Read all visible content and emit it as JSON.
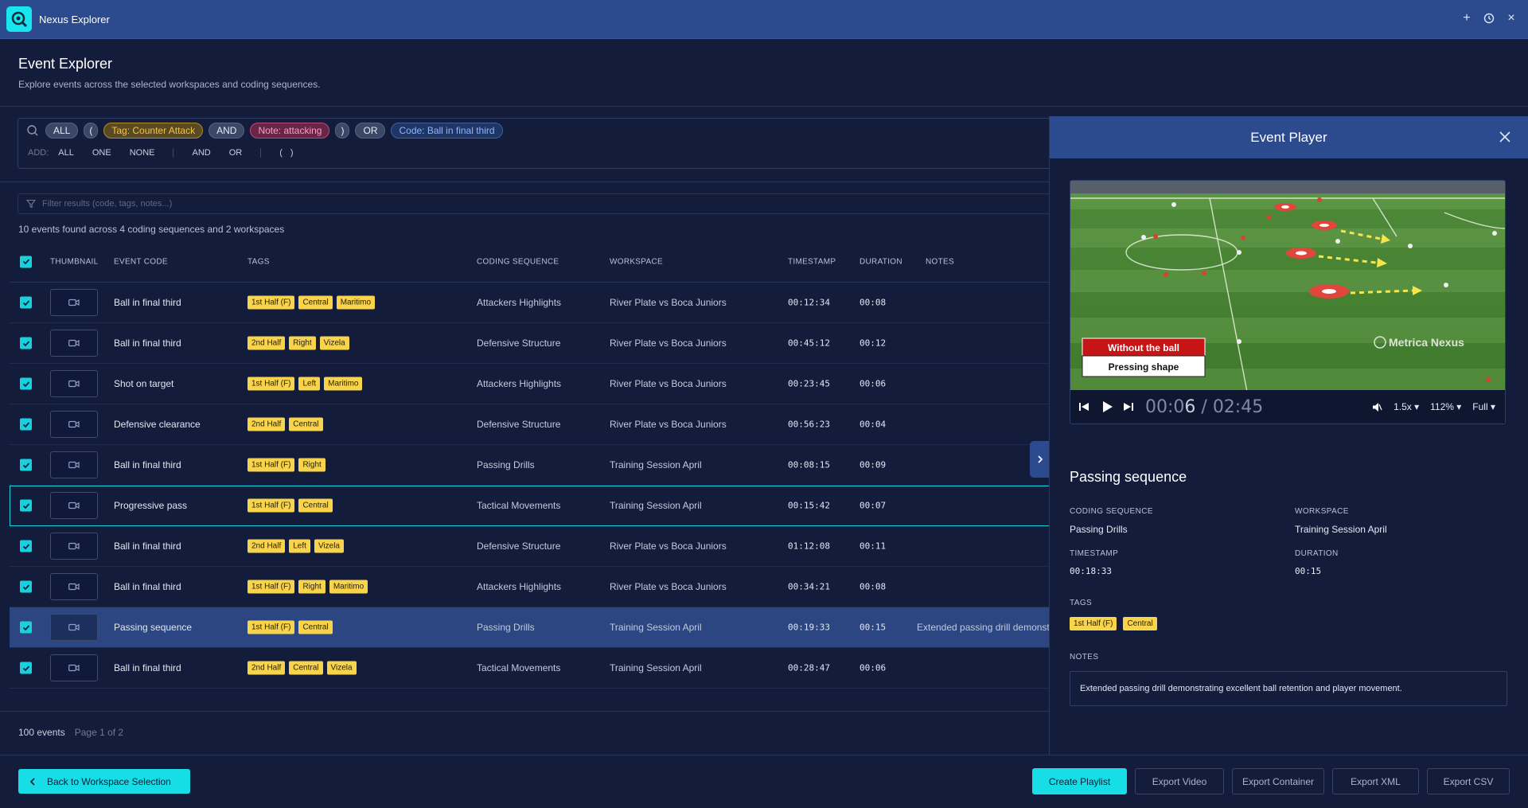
{
  "app": {
    "title": "Nexus Explorer"
  },
  "header": {
    "title": "Event Explorer",
    "subtitle": "Explore events across the selected workspaces and coding sequences."
  },
  "query": {
    "chips": [
      {
        "label": "ALL",
        "kind": "op"
      },
      {
        "label": "(",
        "kind": "op"
      },
      {
        "label": "Tag: Counter Attack",
        "kind": "tag"
      },
      {
        "label": "AND",
        "kind": "op"
      },
      {
        "label": "Note: attacking",
        "kind": "note"
      },
      {
        "label": ")",
        "kind": "op"
      },
      {
        "label": "OR",
        "kind": "op"
      },
      {
        "label": "Code: Ball in final third",
        "kind": "code"
      }
    ],
    "add_label": "ADD:",
    "add_buttons": [
      "ALL",
      "ONE",
      "NONE",
      "AND",
      "OR",
      "(",
      ")"
    ]
  },
  "filter": {
    "placeholder": "Filter results (code, tags, notes...)"
  },
  "results_text": "10 events found across 4 coding sequences and 2 workspaces",
  "table": {
    "headers": {
      "thumbnail": "THUMBNAIL",
      "event_code": "EVENT CODE",
      "tags": "TAGS",
      "coding_sequence": "CODING SEQUENCE",
      "workspace": "WORKSPACE",
      "timestamp": "TIMESTAMP",
      "duration": "DURATION",
      "notes": "NOTES"
    },
    "rows": [
      {
        "code": "Ball in final third",
        "tags": [
          "1st Half (F)",
          "Central",
          "Maritimo"
        ],
        "seq": "Attackers Highlights",
        "ws": "River Plate vs Boca Juniors",
        "ts": "00:12:34",
        "dur": "00:08",
        "notes": ""
      },
      {
        "code": "Ball in final third",
        "tags": [
          "2nd Half",
          "Right",
          "Vizela"
        ],
        "seq": "Defensive Structure",
        "ws": "River Plate vs Boca Juniors",
        "ts": "00:45:12",
        "dur": "00:12",
        "notes": ""
      },
      {
        "code": "Shot on target",
        "tags": [
          "1st Half (F)",
          "Left",
          "Maritimo"
        ],
        "seq": "Attackers Highlights",
        "ws": "River Plate vs Boca Juniors",
        "ts": "00:23:45",
        "dur": "00:06",
        "notes": ""
      },
      {
        "code": "Defensive clearance",
        "tags": [
          "2nd Half",
          "Central"
        ],
        "seq": "Defensive Structure",
        "ws": "River Plate vs Boca Juniors",
        "ts": "00:56:23",
        "dur": "00:04",
        "notes": ""
      },
      {
        "code": "Ball in final third",
        "tags": [
          "1st Half (F)",
          "Right"
        ],
        "seq": "Passing Drills",
        "ws": "Training Session April",
        "ts": "00:08:15",
        "dur": "00:09",
        "notes": ""
      },
      {
        "code": "Progressive pass",
        "tags": [
          "1st Half (F)",
          "Central"
        ],
        "seq": "Tactical Movements",
        "ws": "Training Session April",
        "ts": "00:15:42",
        "dur": "00:07",
        "notes": ""
      },
      {
        "code": "Ball in final third",
        "tags": [
          "2nd Half",
          "Left",
          "Vizela"
        ],
        "seq": "Defensive Structure",
        "ws": "River Plate vs Boca Juniors",
        "ts": "01:12:08",
        "dur": "00:11",
        "notes": ""
      },
      {
        "code": "Ball in final third",
        "tags": [
          "1st Half (F)",
          "Right",
          "Maritimo"
        ],
        "seq": "Attackers Highlights",
        "ws": "River Plate vs Boca Juniors",
        "ts": "00:34:21",
        "dur": "00:08",
        "notes": ""
      },
      {
        "code": "Passing sequence",
        "tags": [
          "1st Half (F)",
          "Central"
        ],
        "seq": "Passing Drills",
        "ws": "Training Session April",
        "ts": "00:19:33",
        "dur": "00:15",
        "notes": "Extended passing drill demonstr"
      },
      {
        "code": "Ball in final third",
        "tags": [
          "2nd Half",
          "Central",
          "Vizela"
        ],
        "seq": "Tactical Movements",
        "ws": "Training Session April",
        "ts": "00:28:47",
        "dur": "00:06",
        "notes": ""
      }
    ]
  },
  "pagination": {
    "total": "100 events",
    "page": "Page 1 of 2"
  },
  "player": {
    "title": "Event Player",
    "overlay_top": "Without the ball",
    "overlay_bottom": "Pressing shape",
    "watermark": "Metrica Nexus",
    "time_current_a": "00:0",
    "time_current_b": "6",
    "time_sep": " / ",
    "time_total": "02:45",
    "speed": "1.5x",
    "zoom": "112%",
    "size": "Full",
    "event_title": "Passing sequence",
    "coding_sequence_label": "CODING SEQUENCE",
    "coding_sequence_value": "Passing Drills",
    "workspace_label": "WORKSPACE",
    "workspace_value": "Training Session April",
    "timestamp_label": "TIMESTAMP",
    "timestamp_value": "00:18:33",
    "duration_label": "DURATION",
    "duration_value": "00:15",
    "tags_label": "TAGS",
    "tags": [
      "1st Half (F)",
      "Central"
    ],
    "notes_label": "NOTES",
    "notes_value": "Extended passing drill demonstrating excellent ball retention and player movement."
  },
  "footer": {
    "back": "Back to Workspace Selection",
    "create_playlist": "Create Playlist",
    "export_video": "Export Video",
    "export_container": "Export Container",
    "export_xml": "Export XML",
    "export_csv": "Export CSV"
  },
  "colors": {
    "accent": "#17dde6",
    "header": "#2c4b8e",
    "tag": "#f7d44c",
    "bg": "#131d3b"
  }
}
